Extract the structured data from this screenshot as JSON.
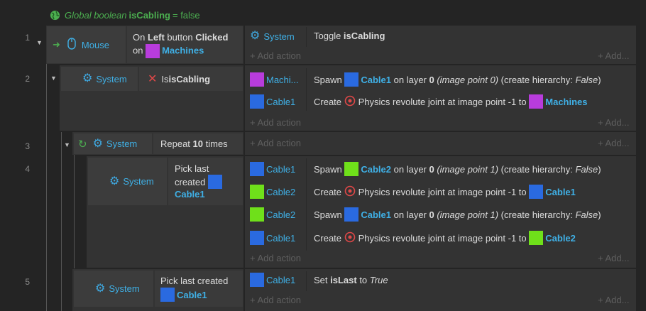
{
  "global": {
    "prefix": "Global boolean ",
    "name": "isCabling",
    "suffix": " = false"
  },
  "colors": {
    "machines": "#b83cdc",
    "cable1": "#2a6ae0",
    "cable2": "#6fe01a",
    "accent": "#3fb0e6"
  },
  "rows": {
    "r1": {
      "num": "1",
      "obj": "Mouse",
      "cond1_pre": "On ",
      "cond1_b1": "Left",
      "cond1_mid": " button ",
      "cond1_b2": "Clicked",
      "cond2": "on ",
      "cond2_obj": "Machines",
      "action_obj": "System",
      "action_pre": "Toggle ",
      "action_b": "isCabling",
      "add_action": "+ Add action",
      "add": "+ Add..."
    },
    "r2": {
      "num": "2",
      "obj": "System",
      "cond_pre": "Is ",
      "cond_b": "isCabling",
      "a1_obj": "Machi...",
      "a1_t1": "Spawn ",
      "a1_o": "Cable1",
      "a1_t2": " on layer ",
      "a1_b": "0",
      "a1_i": " (image point 0)",
      "a1_t3": " (create hierarchy: ",
      "a1_i2": "False",
      "a1_t4": ")",
      "a2_obj": "Cable1",
      "a2_t1": "Create ",
      "a2_t2": "Physics revolute joint at image point -1 to ",
      "a2_o": "Machines",
      "add_action": "+ Add action",
      "add": "+ Add..."
    },
    "r3": {
      "num": "3",
      "obj": "System",
      "cond_pre": "Repeat ",
      "cond_b": "10",
      "cond_post": " times",
      "add_action": "+ Add action",
      "add": "+ Add..."
    },
    "r4": {
      "num": "4",
      "obj": "System",
      "cond_l1": "Pick last",
      "cond_l2": "created",
      "cond_o": "Cable1",
      "a1_obj": "Cable1",
      "a1_t1": "Spawn ",
      "a1_o": "Cable2",
      "a1_t2": " on layer ",
      "a1_b": "0",
      "a1_i": " (image point 1)",
      "a1_t3": " (create hierarchy: ",
      "a1_i2": "False",
      "a1_t4": ")",
      "a2_obj": "Cable2",
      "a2_t1": "Create ",
      "a2_t2": "Physics revolute joint at image point -1 to ",
      "a2_o": "Cable1",
      "a3_obj": "Cable2",
      "a3_t1": "Spawn ",
      "a3_o": "Cable1",
      "a3_t2": " on layer ",
      "a3_b": "0",
      "a3_i": " (image point 1)",
      "a3_t3": " (create hierarchy: ",
      "a3_i2": "False",
      "a3_t4": ")",
      "a4_obj": "Cable1",
      "a4_t1": "Create ",
      "a4_t2": "Physics revolute joint at image point -1 to ",
      "a4_o": "Cable2",
      "add_action": "+ Add action",
      "add": "+ Add..."
    },
    "r5": {
      "num": "5",
      "obj": "System",
      "cond_l1": "Pick last created",
      "cond_o": "Cable1",
      "a1_obj": "Cable1",
      "a1_t1": "Set ",
      "a1_b": "isLast",
      "a1_t2": " to ",
      "a1_i": "True",
      "add_action": "+ Add action",
      "add": "+ Add..."
    }
  }
}
